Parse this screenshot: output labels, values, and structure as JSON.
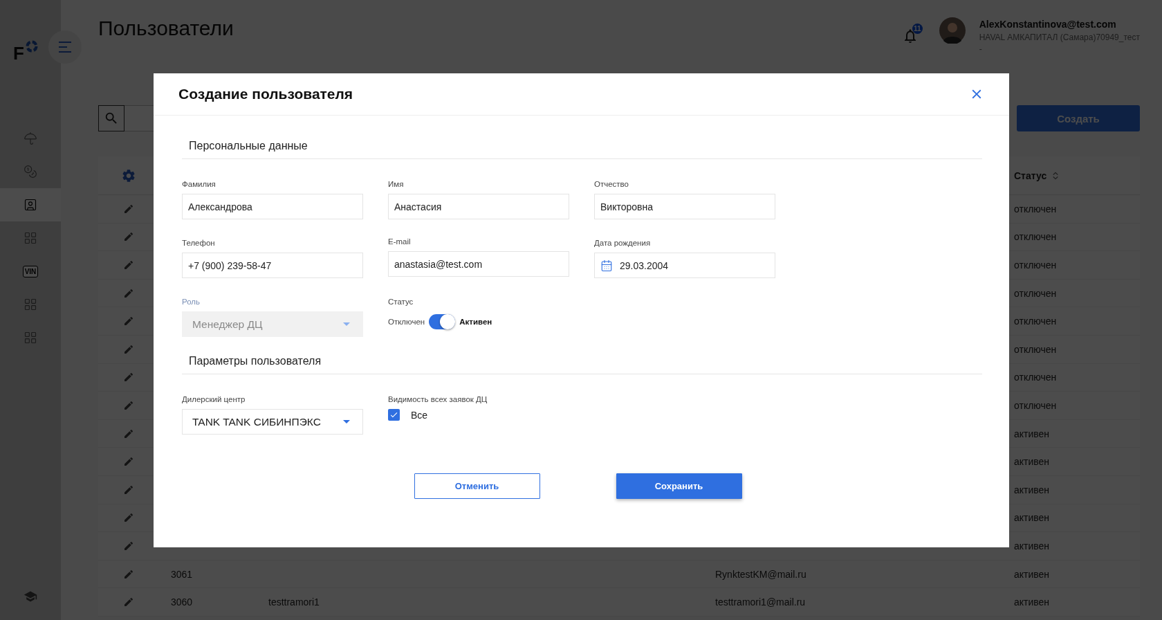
{
  "sidebar": {
    "logo": "F",
    "items": [
      {
        "kind": "umbrella",
        "selected": false
      },
      {
        "kind": "coins",
        "selected": false
      },
      {
        "kind": "user",
        "selected": true
      },
      {
        "kind": "grid",
        "selected": false
      },
      {
        "kind": "vin",
        "label": "VIN",
        "selected": false
      },
      {
        "kind": "grid",
        "selected": false
      },
      {
        "kind": "grid",
        "selected": false
      }
    ]
  },
  "header": {
    "title": "Пользователи",
    "notifications": "11",
    "user": {
      "email": "AlexKonstantinova@test.com",
      "company": "HAVAL АМКАПИТАЛ (Самара)70949_тест",
      "extra": "-"
    }
  },
  "toolbar": {
    "create_button": "Создать"
  },
  "table": {
    "status_header": "Статус",
    "rows": [
      {
        "status": "отключен"
      },
      {
        "status": "отключен"
      },
      {
        "status": "отключен"
      },
      {
        "status": "отключен"
      },
      {
        "status": "отключен"
      },
      {
        "status": "отключен"
      },
      {
        "status": "отключен"
      },
      {
        "status": "отключен"
      },
      {
        "status": "активен"
      },
      {
        "status": "активен"
      },
      {
        "status": "активен"
      },
      {
        "status": "активен"
      },
      {
        "status": "активен"
      },
      {
        "id": "3061",
        "email": "RynktestKM@mail.ru",
        "status": "активен"
      },
      {
        "id": "3060",
        "name": "testtramori1",
        "email": "testtramori1@mail.ru",
        "status": "активен"
      }
    ]
  },
  "dialog": {
    "title": "Создание пользователя",
    "sections": [
      {
        "title": "Персональные данные",
        "fields": [
          {
            "kind": "text",
            "label": "Фамилия",
            "value": "Александрова"
          },
          {
            "kind": "text",
            "label": "Имя",
            "value": "Анастасия"
          },
          {
            "kind": "text",
            "label": "Отчество",
            "value": "Викторовна"
          },
          {
            "kind": "text",
            "label": "Телефон",
            "value": "+7 (900) 239-58-47"
          },
          {
            "kind": "text",
            "label": "E-mail",
            "value": "anastasia@test.com"
          },
          {
            "kind": "date",
            "label": "Дата рождения",
            "value": "29.03.2004"
          },
          {
            "kind": "select",
            "label": "Роль",
            "value": "Менеджер ДЦ",
            "disabled": true
          },
          {
            "kind": "toggle",
            "label": "Статус",
            "off_label": "Отключен",
            "on_label": "Активен",
            "on": true
          }
        ]
      },
      {
        "title": "Параметры пользователя",
        "fields": [
          {
            "kind": "select",
            "label": "Дилерский центр",
            "value": "TANK TANK СИБИНПЭКС",
            "disabled": false
          },
          {
            "kind": "checkbox",
            "label": "Видимость всех заявок ДЦ",
            "option": "Все",
            "checked": true
          }
        ]
      }
    ],
    "buttons": [
      {
        "kind": "secondary",
        "label": "Отменить"
      },
      {
        "kind": "primary",
        "label": "Сохранить"
      }
    ]
  }
}
